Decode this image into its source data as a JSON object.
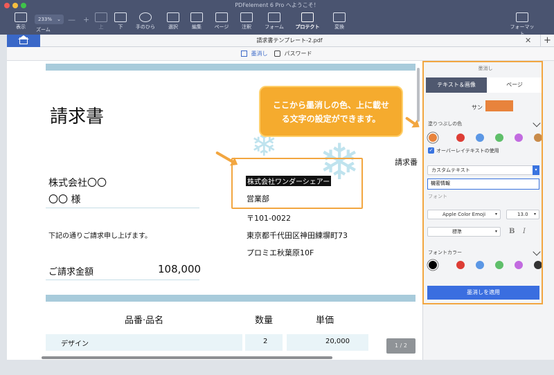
{
  "app": {
    "title": "PDFelement 6 Pro へようこそ！"
  },
  "toolbar": {
    "view_label": "表示",
    "zoom_value": "233%",
    "zoom_label": "ズーム",
    "up_label": "上",
    "down_label": "下",
    "hand_label": "手のひら",
    "select_label": "選択",
    "edit_label": "編集",
    "page_label": "ページ",
    "comment_label": "注釈",
    "form_label": "フォーム",
    "protect_label": "プロテクト",
    "convert_label": "変換",
    "format_label": "フォーマット"
  },
  "tabs": {
    "document": "請求書テンプレート-2.pdf"
  },
  "subtoolbar": {
    "redact_label": "墨消し",
    "password_label": "パスワード"
  },
  "document": {
    "title": "請求書",
    "company": "株式会社〇〇",
    "customer": "〇〇 様",
    "note": "下記の通りご請求申し上げます。",
    "amount_label": "ご請求金額",
    "amount_value": "108,000",
    "invoice_no_label": "請求番",
    "redacted_text": "株式会社ワンダーシェアー",
    "dept": "営業部",
    "postal": "〒101-0022",
    "address": "東京都千代田区神田練塀町73",
    "building": "プロミエ秋葉原10F",
    "table_headers": [
      "品番·品名",
      "数量",
      "単価"
    ],
    "rows": [
      {
        "item": "デザイン",
        "qty": "2",
        "price": "20,000"
      }
    ],
    "page_indicator": "1 / 2"
  },
  "callout": {
    "line1": "ここから墨消しの色、上に載せ",
    "line2": "る文字の設定ができます。"
  },
  "panel": {
    "title": "墨消し",
    "tab_text_image": "テキスト＆画像",
    "tab_page": "ページ",
    "sample_label": "サン",
    "fill_color_label": "塗りつぶしの色",
    "overlay_label": "オーバーレイテキストの使用",
    "custom_text_option": "カスタムテキスト",
    "overlay_text_value": "機密情報",
    "font_hint": "フォント",
    "font_family": "Apple Color Emoji",
    "font_size": "13.0",
    "font_style": "標準",
    "bold_label": "B",
    "italic_label": "I",
    "font_color_label": "フォントカラー",
    "apply_button": "墨消しを適用"
  },
  "colors": {
    "fill_selected": "#e8833c",
    "swatches": [
      "#e8833c",
      "#dd3d35",
      "#5b97e5",
      "#5fbf6a",
      "#c26be0",
      "#c98b4a"
    ],
    "font_swatches": [
      "#000000",
      "#dd3d35",
      "#5b97e5",
      "#5fbf6a",
      "#c26be0",
      "#333333"
    ],
    "accent": "#3a6ee0",
    "highlight": "#f2a640"
  }
}
